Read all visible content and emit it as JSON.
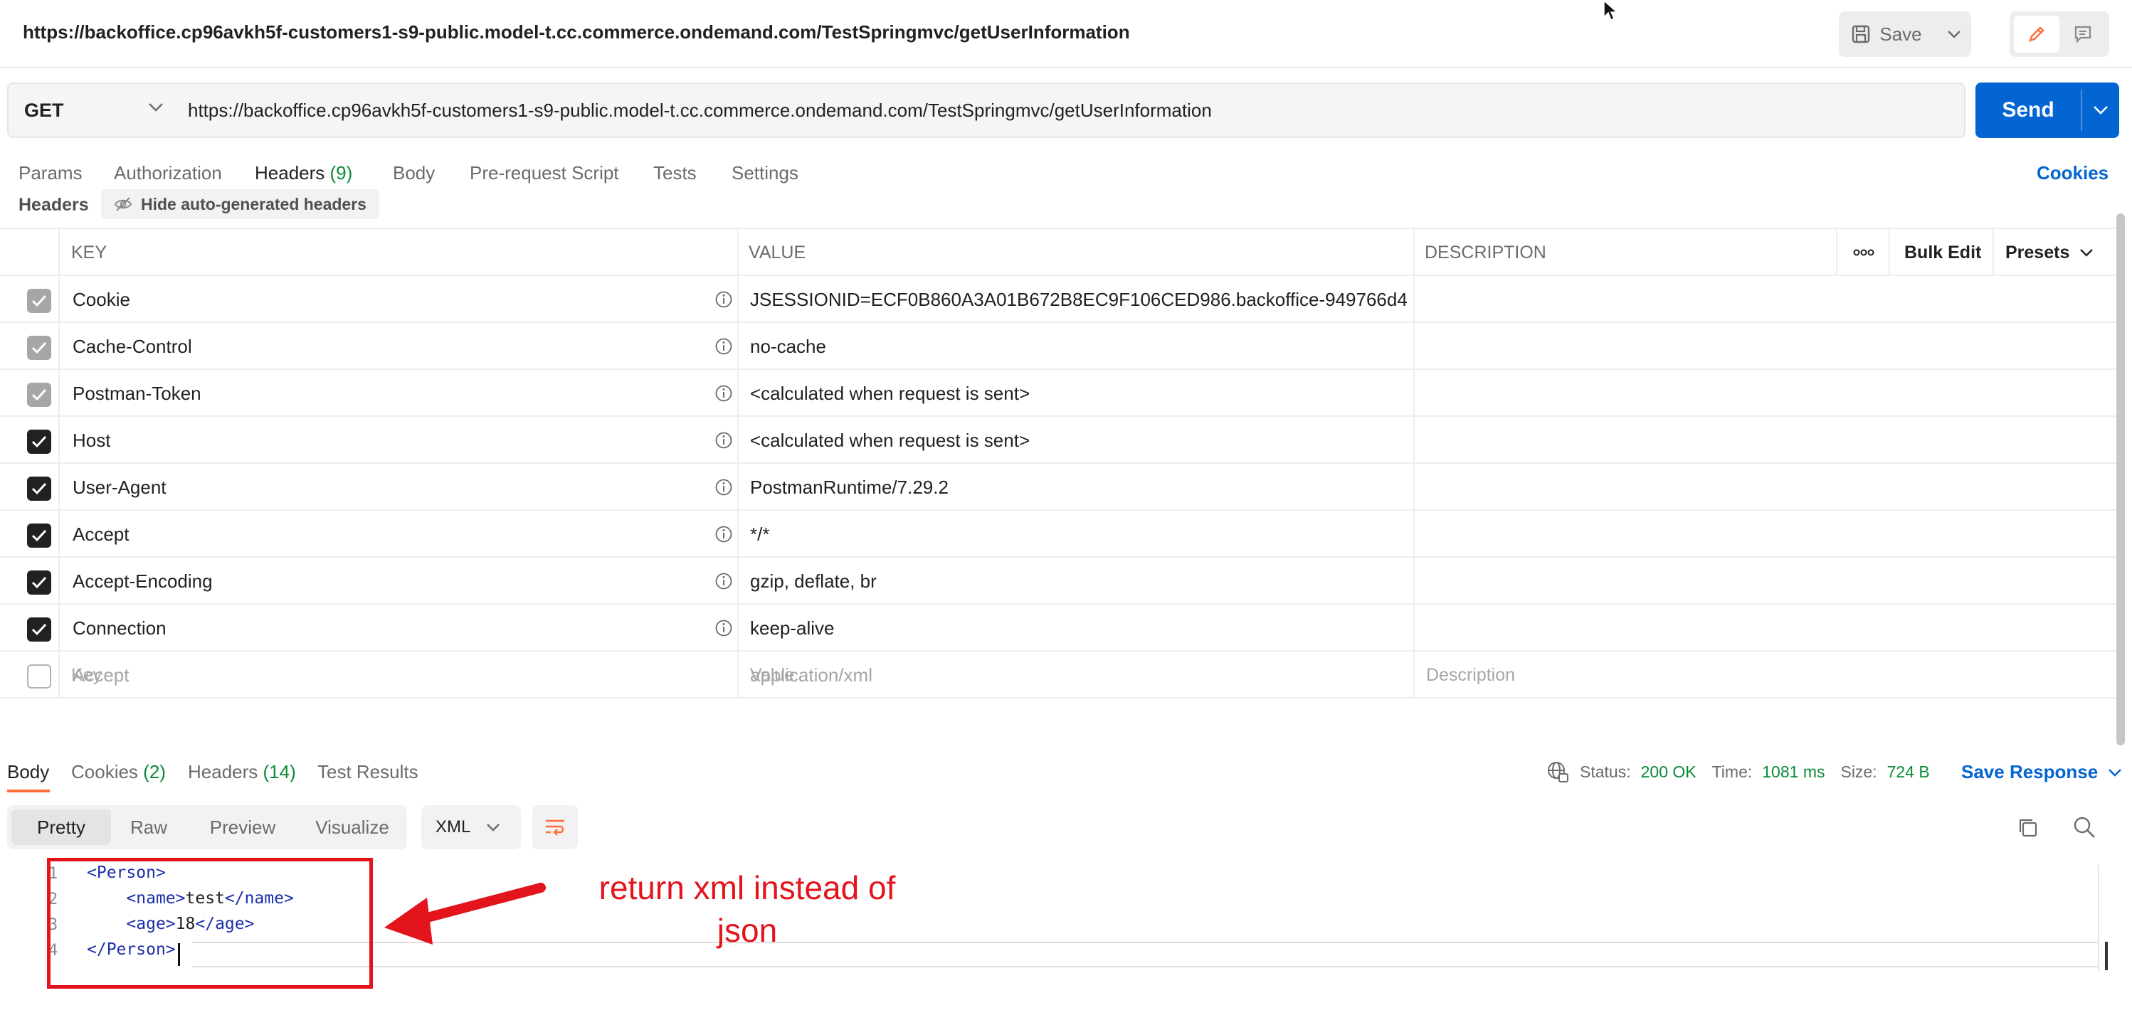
{
  "window": {
    "title_url": "https://backoffice.cp96avkh5f-customers1-s9-public.model-t.cc.commerce.ondemand.com/TestSpringmvc/getUserInformation",
    "save_label": "Save"
  },
  "request": {
    "method": "GET",
    "url": "https://backoffice.cp96avkh5f-customers1-s9-public.model-t.cc.commerce.ondemand.com/TestSpringmvc/getUserInformation",
    "send_label": "Send"
  },
  "request_tabs": {
    "params": "Params",
    "authorization": "Authorization",
    "headers": "Headers",
    "headers_count": "(9)",
    "body": "Body",
    "pre_request": "Pre-request Script",
    "tests": "Tests",
    "settings": "Settings",
    "cookies": "Cookies"
  },
  "headers_section": {
    "title": "Headers",
    "hide_auto": "Hide auto-generated headers"
  },
  "headers_table": {
    "col_key": "KEY",
    "col_value": "VALUE",
    "col_description": "DESCRIPTION",
    "bulk_edit": "Bulk Edit",
    "presets": "Presets",
    "rows": [
      {
        "key": "Cookie",
        "value": "JSESSIONID=ECF0B860A3A01B672B8EC9F106CED986.backoffice-949766d4...",
        "state": "gray"
      },
      {
        "key": "Cache-Control",
        "value": "no-cache",
        "state": "gray"
      },
      {
        "key": "Postman-Token",
        "value": "<calculated when request is sent>",
        "state": "gray"
      },
      {
        "key": "Host",
        "value": "<calculated when request is sent>",
        "state": "on"
      },
      {
        "key": "User-Agent",
        "value": "PostmanRuntime/7.29.2",
        "state": "on"
      },
      {
        "key": "Accept",
        "value": "*/*",
        "state": "on"
      },
      {
        "key": "Accept-Encoding",
        "value": "gzip, deflate, br",
        "state": "on"
      },
      {
        "key": "Connection",
        "value": "keep-alive",
        "state": "on"
      },
      {
        "key": "Accept",
        "value": "application/xml",
        "state": "off"
      }
    ],
    "placeholder_key": "Key",
    "placeholder_value": "Value",
    "placeholder_description": "Description"
  },
  "response": {
    "tab_body": "Body",
    "tab_cookies": "Cookies",
    "cookies_count": "(2)",
    "tab_headers": "Headers",
    "headers_count": "(14)",
    "tab_tests": "Test Results",
    "status_label": "Status:",
    "status_value": "200 OK",
    "time_label": "Time:",
    "time_value": "1081 ms",
    "size_label": "Size:",
    "size_value": "724 B",
    "save_response": "Save Response",
    "views": [
      "Pretty",
      "Raw",
      "Preview",
      "Visualize"
    ],
    "format": "XML",
    "code_lines": [
      {
        "num": "1",
        "open": "Person",
        "text": "",
        "close": ""
      },
      {
        "num": "2",
        "open": "name",
        "text": "test",
        "close": "name"
      },
      {
        "num": "3",
        "open": "age",
        "text": "18",
        "close": "age"
      },
      {
        "num": "4",
        "open": "",
        "text": "",
        "close": "Person"
      }
    ]
  },
  "annotation": {
    "line1": "return xml instead of",
    "line2": "json",
    "color": "#e3141b"
  },
  "colors": {
    "accent": "#ff6c37",
    "send": "#0265d2",
    "link": "#0265d2",
    "count_green": "#0a8a3a"
  }
}
